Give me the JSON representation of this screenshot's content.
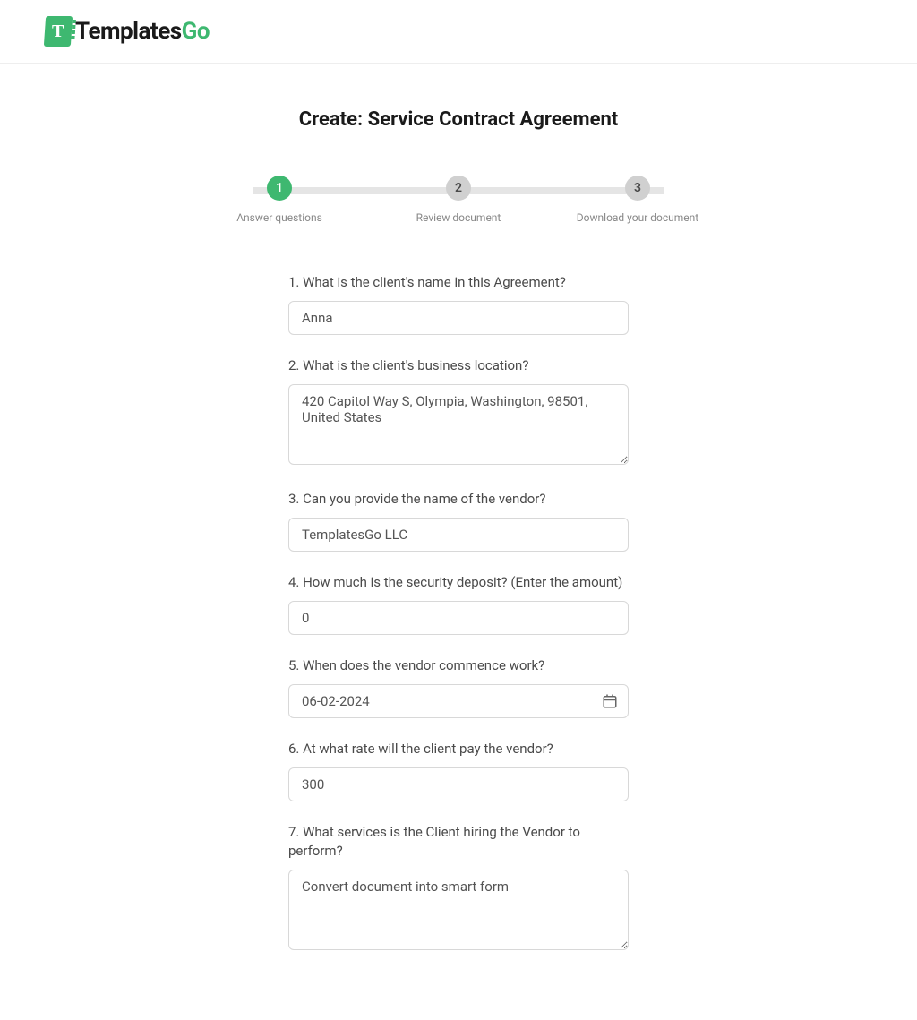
{
  "brand": {
    "name_part1": "Templates",
    "name_part2": "Go",
    "icon_letter": "T"
  },
  "page_title": "Create: Service Contract Agreement",
  "steps": [
    {
      "number": "1",
      "label": "Answer questions",
      "active": true
    },
    {
      "number": "2",
      "label": "Review document",
      "active": false
    },
    {
      "number": "3",
      "label": "Download your document",
      "active": false
    }
  ],
  "questions": [
    {
      "label": "1. What is the client's name in this Agreement?",
      "type": "text",
      "value": "Anna"
    },
    {
      "label": "2. What is the client's business location?",
      "type": "textarea",
      "value": "420 Capitol Way S, Olympia, Washington, 98501, United States"
    },
    {
      "label": "3. Can you provide the name of the vendor?",
      "type": "text",
      "value": "TemplatesGo LLC"
    },
    {
      "label": "4. How much is the security deposit? (Enter the amount)",
      "type": "text",
      "value": "0"
    },
    {
      "label": "5. When does the vendor commence work?",
      "type": "date",
      "value": "06-02-2024"
    },
    {
      "label": "6. At what rate will the client pay the vendor?",
      "type": "text",
      "value": "300"
    },
    {
      "label": "7. What services is the Client hiring the Vendor to perform?",
      "type": "textarea",
      "value": "Convert document into smart form"
    }
  ]
}
